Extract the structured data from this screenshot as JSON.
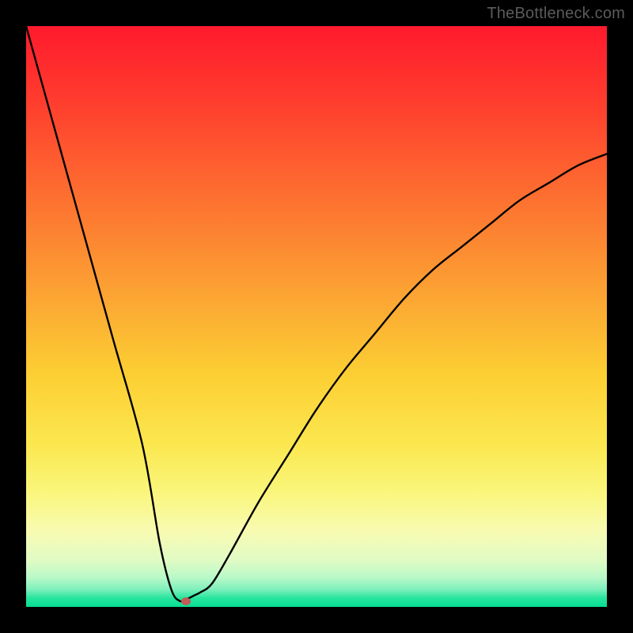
{
  "watermark": "TheBottleneck.com",
  "colors": {
    "frame": "#000000",
    "curve": "#000000",
    "dot": "#c25a55",
    "gradient_stops": [
      "#ff1a2c",
      "#ff3a2e",
      "#fd6b30",
      "#fca033",
      "#fccf33",
      "#fbe74f",
      "#faf67a",
      "#f8fbb2",
      "#e0fbc4",
      "#b8f9c8",
      "#7df0bb",
      "#26e49d",
      "#05df93"
    ]
  },
  "chart_data": {
    "type": "line",
    "title": "",
    "xlabel": "",
    "ylabel": "",
    "xlim": [
      0,
      100
    ],
    "ylim": [
      0,
      100
    ],
    "grid": false,
    "legend": false,
    "series": [
      {
        "name": "bottleneck-curve",
        "x": [
          0,
          5,
          10,
          15,
          20,
          23,
          25,
          26.5,
          28,
          29,
          30,
          32,
          35,
          40,
          45,
          50,
          55,
          60,
          65,
          70,
          75,
          80,
          85,
          90,
          95,
          100
        ],
        "y": [
          100,
          82,
          64,
          46,
          28,
          11,
          3,
          1,
          1.5,
          2,
          2.5,
          4,
          9,
          18,
          26,
          34,
          41,
          47,
          53,
          58,
          62,
          66,
          70,
          73,
          76,
          78
        ]
      }
    ],
    "marker": {
      "x": 27.5,
      "y": 1
    }
  }
}
